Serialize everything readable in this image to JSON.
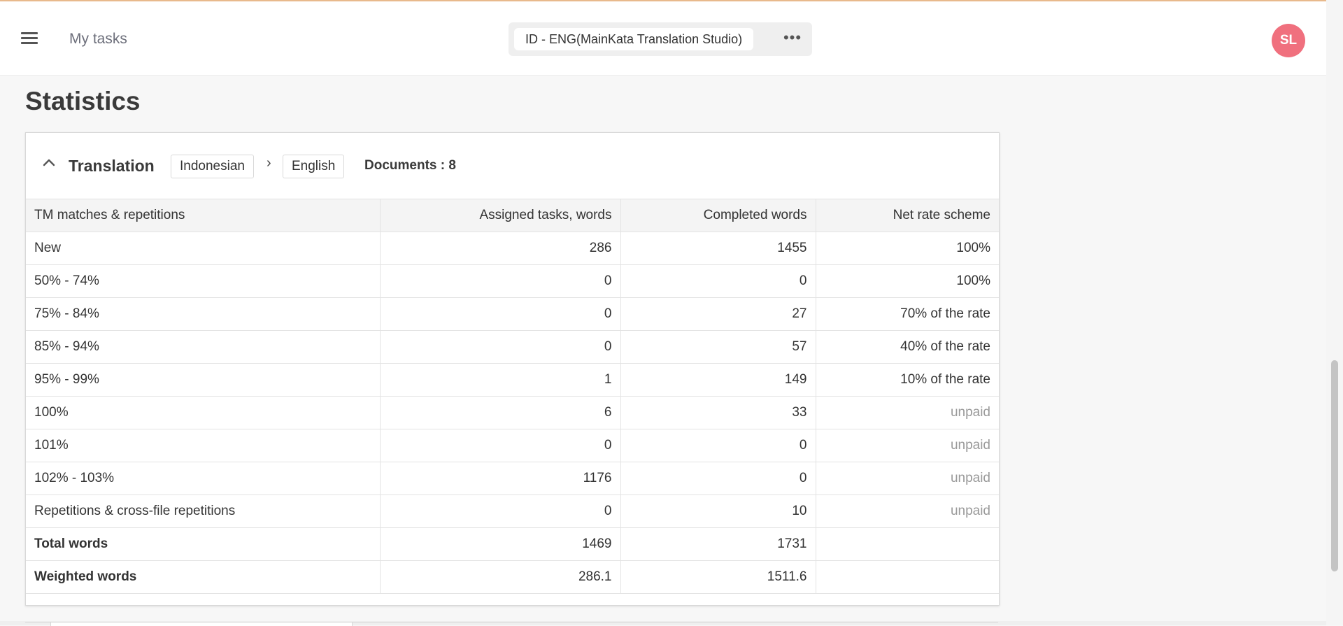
{
  "header": {
    "menu_icon": "hamburger-menu-icon",
    "nav_title": "My tasks",
    "project_name": "ID - ENG(MainKata Translation Studio)",
    "more_icon": "more-horizontal-icon",
    "avatar_initials": "SL",
    "avatar_color": "#f0707e"
  },
  "page": {
    "title": "Statistics"
  },
  "section": {
    "collapse_icon": "chevron-up-icon",
    "title": "Translation",
    "source_language": "Indonesian",
    "arrow": "›",
    "target_language": "English",
    "documents_label": "Documents : 8"
  },
  "table": {
    "columns": [
      "TM matches & repetitions",
      "Assigned tasks, words",
      "Completed words",
      "Net rate scheme"
    ],
    "rows": [
      {
        "label": "New",
        "assigned": "286",
        "completed": "1455",
        "rate": "100%"
      },
      {
        "label": "50% - 74%",
        "assigned": "0",
        "completed": "0",
        "rate": "100%"
      },
      {
        "label": "75% - 84%",
        "assigned": "0",
        "completed": "27",
        "rate": "70% of the rate"
      },
      {
        "label": "85% - 94%",
        "assigned": "0",
        "completed": "57",
        "rate": "40% of the rate"
      },
      {
        "label": "95% - 99%",
        "assigned": "1",
        "completed": "149",
        "rate": "10% of the rate"
      },
      {
        "label": "100%",
        "assigned": "6",
        "completed": "33",
        "rate": "unpaid"
      },
      {
        "label": "101%",
        "assigned": "0",
        "completed": "0",
        "rate": "unpaid"
      },
      {
        "label": "102% - 103%",
        "assigned": "1176",
        "completed": "0",
        "rate": "unpaid"
      },
      {
        "label": "Repetitions & cross-file repetitions",
        "assigned": "0",
        "completed": "10",
        "rate": "unpaid"
      }
    ],
    "totals": [
      {
        "label": "Total words",
        "assigned": "1469",
        "completed": "1731",
        "rate": ""
      },
      {
        "label": "Weighted words",
        "assigned": "286.1",
        "completed": "1511.6",
        "rate": ""
      }
    ]
  }
}
